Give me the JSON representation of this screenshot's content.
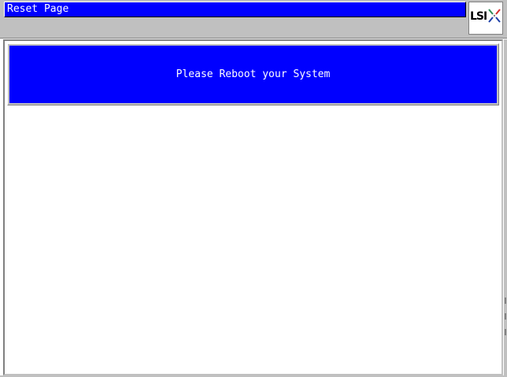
{
  "window": {
    "title": "Reset Page"
  },
  "logo": {
    "text": "LSI",
    "icon": "lsi-logo-icon",
    "mark_colors": [
      "#2e8b57",
      "#d32f2f",
      "#1e3fa8",
      "#1e3fa8"
    ]
  },
  "main": {
    "message": "Please Reboot your System"
  },
  "colors": {
    "title_bar": "#0000ff",
    "message_panel": "#0000ff",
    "chrome": "#c0c0c0",
    "text_on_blue": "#ffffff"
  }
}
